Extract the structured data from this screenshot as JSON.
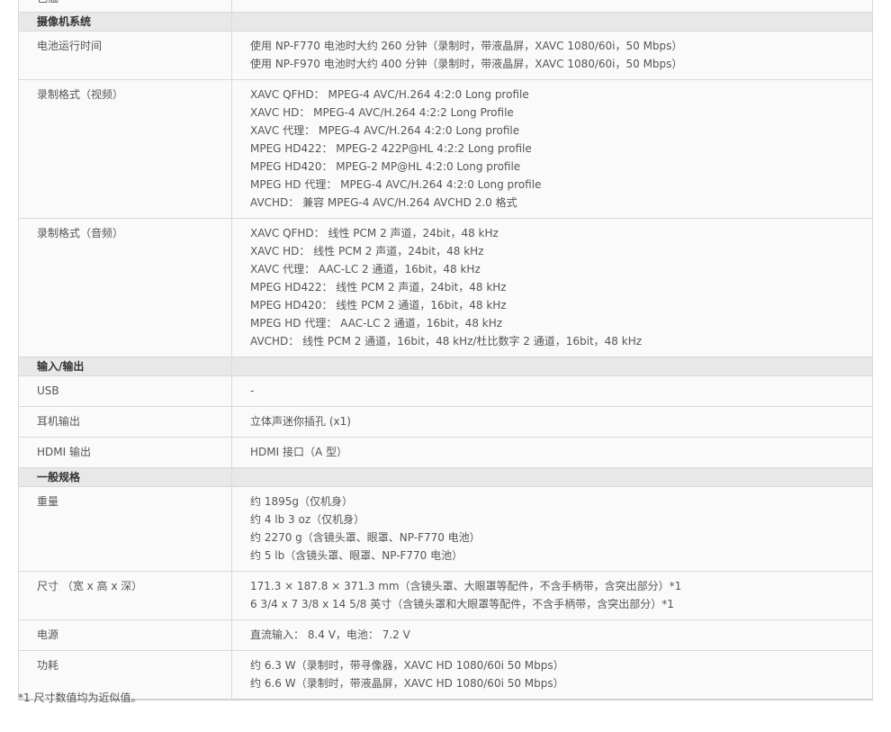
{
  "sections": [
    {
      "title": "",
      "rows": [
        {
          "label": "色温",
          "values": [
            ""
          ]
        }
      ]
    },
    {
      "title": "摄像机系统",
      "rows": [
        {
          "label": "电池运行时间",
          "values": [
            "使用 NP-F770 电池时大约 260 分钟（录制时，带液晶屏，XAVC 1080/60i，50 Mbps）",
            "使用 NP-F970 电池时大约 400 分钟（录制时，带液晶屏，XAVC 1080/60i，50 Mbps）"
          ]
        },
        {
          "label": "录制格式（视频）",
          "values": [
            "XAVC QFHD： MPEG-4 AVC/H.264 4:2:0 Long profile",
            "XAVC HD： MPEG-4 AVC/H.264 4:2:2 Long Profile",
            "XAVC 代理： MPEG-4 AVC/H.264 4:2:0 Long profile",
            "MPEG HD422： MPEG-2 422P@HL 4:2:2 Long profile",
            "MPEG HD420： MPEG-2 MP@HL 4:2:0 Long profile",
            "MPEG HD 代理： MPEG-4 AVC/H.264 4:2:0 Long profile",
            "AVCHD： 兼容 MPEG-4 AVC/H.264 AVCHD 2.0 格式"
          ]
        },
        {
          "label": "录制格式（音频）",
          "values": [
            "XAVC QFHD： 线性 PCM 2 声道，24bit，48 kHz",
            "XAVC HD： 线性 PCM 2 声道，24bit，48 kHz",
            "XAVC 代理： AAC-LC 2 通道，16bit，48 kHz",
            "MPEG HD422： 线性 PCM 2 声道，24bit，48 kHz",
            "MPEG HD420： 线性 PCM 2 通道，16bit，48 kHz",
            "MPEG HD 代理： AAC-LC 2 通道，16bit，48 kHz",
            "AVCHD： 线性 PCM 2 通道，16bit，48 kHz/杜比数字 2 通道，16bit，48 kHz"
          ]
        }
      ]
    },
    {
      "title": "输入/输出",
      "rows": [
        {
          "label": "USB",
          "values": [
            "-"
          ]
        },
        {
          "label": "耳机输出",
          "values": [
            "立体声迷你插孔 (x1)"
          ]
        },
        {
          "label": "HDMI 输出",
          "values": [
            "HDMI 接口（A 型）"
          ]
        }
      ]
    },
    {
      "title": "一般规格",
      "rows": [
        {
          "label": "重量",
          "values": [
            "约 1895g（仅机身）",
            "约 4 lb 3 oz（仅机身）",
            "约 2270 g（含镜头罩、眼罩、NP-F770 电池）",
            "约 5 lb（含镜头罩、眼罩、NP-F770 电池）"
          ]
        },
        {
          "label": "尺寸 （宽 x 高 x 深）",
          "values": [
            "171.3 × 187.8 × 371.3 mm（含镜头罩、大眼罩等配件，不含手柄带，含突出部分）*1",
            "6 3/4 x 7 3/8 x 14 5/8 英寸（含镜头罩和大眼罩等配件，不含手柄带，含突出部分）*1"
          ]
        },
        {
          "label": "电源",
          "values": [
            "直流输入： 8.4 V，电池： 7.2 V"
          ]
        },
        {
          "label": "功耗",
          "values": [
            "约 6.3 W（录制时，带寻像器，XAVC HD 1080/60i 50 Mbps）",
            "约 6.6 W（录制时，带液晶屏，XAVC HD 1080/60i 50 Mbps）"
          ]
        }
      ]
    }
  ],
  "footnote": "*1 尺寸数值均为近似值。"
}
